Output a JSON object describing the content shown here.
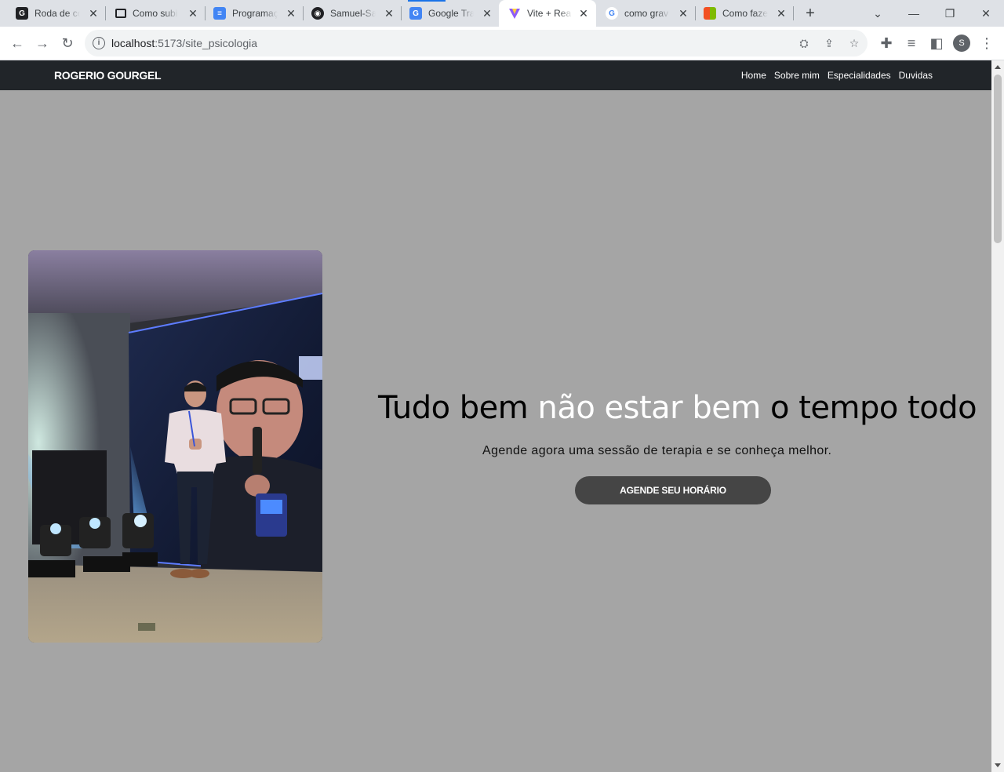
{
  "browser": {
    "tabs": [
      {
        "title": "Roda de co",
        "icon": "globe-icon",
        "color": "#202124",
        "glyph": "G"
      },
      {
        "title": "Como subi",
        "icon": "folder-icon",
        "color": "#202124",
        "glyph": "▭"
      },
      {
        "title": "Programaç",
        "icon": "docs-icon",
        "color": "#4285f4",
        "glyph": "≡"
      },
      {
        "title": "Samuel-Sa",
        "icon": "github-icon",
        "color": "#202124",
        "glyph": "●"
      },
      {
        "title": "Google Tra",
        "icon": "translate-icon",
        "color": "#4285f4",
        "glyph": "G"
      },
      {
        "title": "Vite + Rea",
        "icon": "vite-icon",
        "color": "#8e5cf7",
        "glyph": "▼"
      },
      {
        "title": "como grav",
        "icon": "google-icon",
        "color": "#ffffff",
        "glyph": "G"
      },
      {
        "title": "Como faze",
        "icon": "microsoft-icon",
        "color": "#f25022",
        "glyph": "▦"
      }
    ],
    "active_tab_index": 5,
    "new_tab_glyph": "+",
    "url_host": "localhost",
    "url_path": ":5173/site_psicologia",
    "profile_initial": "S"
  },
  "site": {
    "brand": "ROGERIO GOURGEL",
    "nav": {
      "home": "Home",
      "about": "Sobre mim",
      "specialties": "Especialidades",
      "faq": "Duvidas"
    },
    "hero": {
      "headline_part1": "Tudo bem ",
      "headline_highlight": "não estar bem",
      "headline_part2": " o tempo todo",
      "subtitle": "Agende agora uma sessão de terapia e se conheça melhor.",
      "cta_label": "AGENDE SEU HORÁRIO",
      "photo_icon": "speaker-photo"
    },
    "colors": {
      "page_bg": "#a5a5a5",
      "navbar_bg": "#212529",
      "cta_bg": "#454545",
      "highlight": "#ffffff"
    }
  }
}
